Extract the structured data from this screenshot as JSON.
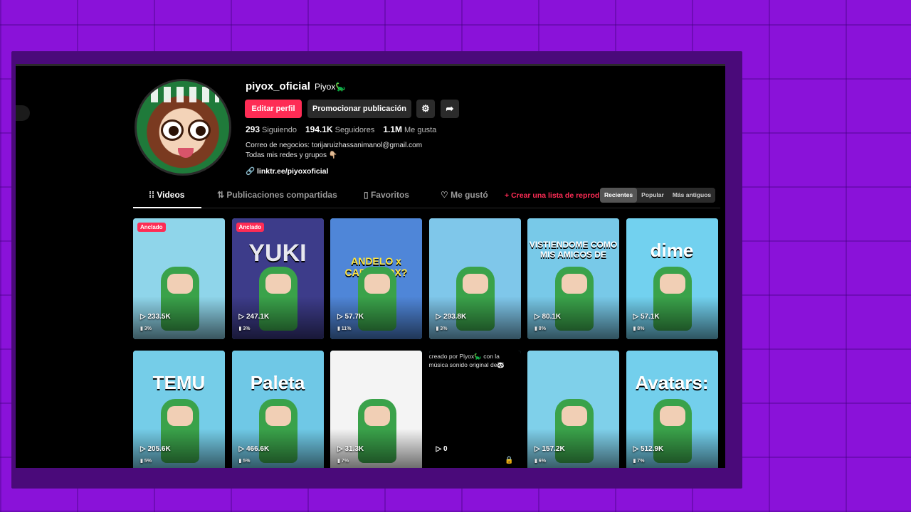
{
  "profile": {
    "username": "piyox_oficial",
    "nickname": "Piyox🦕",
    "edit_label": "Editar perfil",
    "promo_label": "Promocionar publicación",
    "following_count": "293",
    "following_label": "Siguiendo",
    "followers_count": "194.1K",
    "followers_label": "Seguidores",
    "likes_count": "1.1M",
    "likes_label": "Me gusta",
    "bio_line1": "Correo de negocios: torijaruizhassanimanol@gmail.com",
    "bio_line2": "Todas mis redes y grupos 👇🏼",
    "link": "linktr.ee/piyoxoficial"
  },
  "tabs": [
    {
      "label": "Videos",
      "icon": "grid-icon"
    },
    {
      "label": "Publicaciones compartidas",
      "icon": "repost-icon"
    },
    {
      "label": "Favoritos",
      "icon": "bookmark-icon"
    },
    {
      "label": "Me gustó",
      "icon": "heart-icon"
    }
  ],
  "create_list": "Crear una lista de reproducción",
  "sort": [
    "Recientes",
    "Popular",
    "Más antiguos"
  ],
  "videos": [
    {
      "views": "233.5K",
      "pct": "3%",
      "pinned": "Anclado",
      "caption": "",
      "bg": "#8fd5ea"
    },
    {
      "views": "247.1K",
      "pct": "3%",
      "pinned": "Anclado",
      "caption": "YUKI",
      "bg": "#3d3c8a"
    },
    {
      "views": "57.7K",
      "pct": "11%",
      "pinned": "",
      "caption": "ANDELO x CARDEVOX?",
      "bg": "#4f86d8"
    },
    {
      "views": "293.8K",
      "pct": "3%",
      "pinned": "",
      "caption": "",
      "bg": "#7fc7ea"
    },
    {
      "views": "80.1K",
      "pct": "8%",
      "pinned": "",
      "caption": "VISTIENDOME COMO MIS AMIGOS DE",
      "bg": "#78c9e8"
    },
    {
      "views": "57.1K",
      "pct": "8%",
      "pinned": "",
      "caption": "dime",
      "bg": "#72d1ef"
    },
    {
      "views": "205.6K",
      "pct": "5%",
      "pinned": "",
      "caption": "TEMU",
      "bg": "#75cde8"
    },
    {
      "views": "466.6K",
      "pct": "5%",
      "pinned": "",
      "caption": "Paleta",
      "bg": "#6fc8e6"
    },
    {
      "views": "31.3K",
      "pct": "7%",
      "pinned": "",
      "caption": "",
      "bg": "#f4f4f4"
    },
    {
      "views": "0",
      "pct": "",
      "pinned": "",
      "caption": "",
      "bg": "#000000",
      "alt": "creado por Piyox🦕 con la música sonido original de🐼",
      "locked": true
    },
    {
      "views": "157.2K",
      "pct": "6%",
      "pinned": "",
      "caption": "",
      "bg": "#7fd0ea"
    },
    {
      "views": "512.9K",
      "pct": "7%",
      "pinned": "",
      "caption": "Avatars:",
      "bg": "#73cfec"
    }
  ]
}
